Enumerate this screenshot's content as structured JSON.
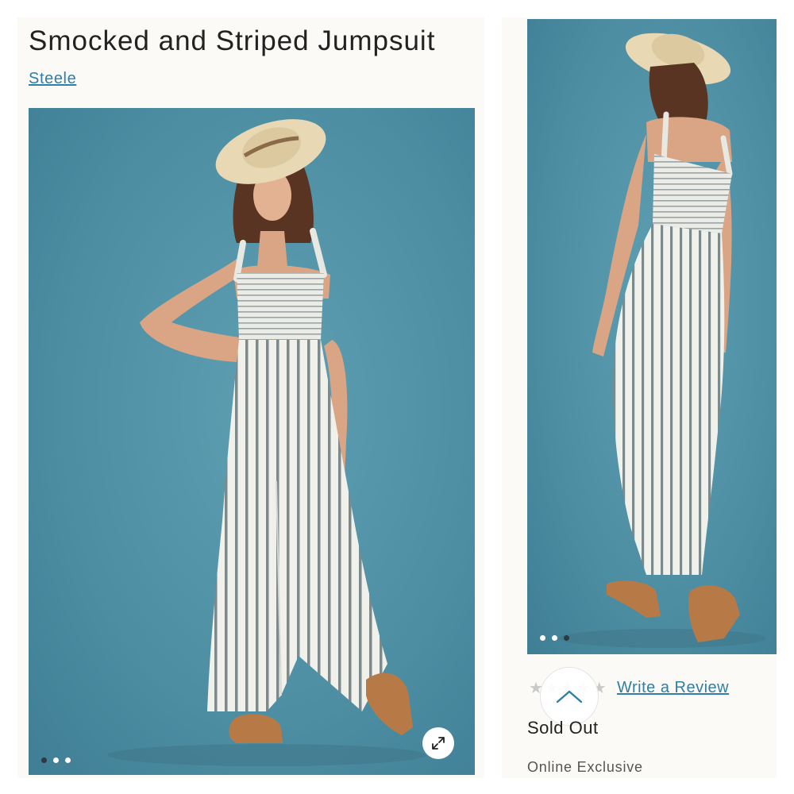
{
  "product": {
    "title": "Smocked and Striped Jumpsuit",
    "brand": "Steele",
    "status": "Sold Out",
    "availability": "Online Exclusive"
  },
  "reviews": {
    "write_review_label": "Write a Review",
    "stars": [
      "★",
      "★",
      "★",
      "★",
      "★"
    ]
  },
  "gallery": {
    "main": {
      "description": "front view model photo",
      "active_dot": 1,
      "dot_count": 3
    },
    "alt": {
      "description": "back view model photo",
      "active_dot": 3,
      "dot_count": 3
    }
  },
  "icons": {
    "expand": "expand-arrows-icon",
    "scroll_top": "chevron-up-icon",
    "star": "star-icon"
  },
  "colors": {
    "link": "#2f7fa6",
    "photo_background": "#4d8ea3",
    "panel_background": "#fbfaf6",
    "stripe": "#7d8a8c"
  }
}
